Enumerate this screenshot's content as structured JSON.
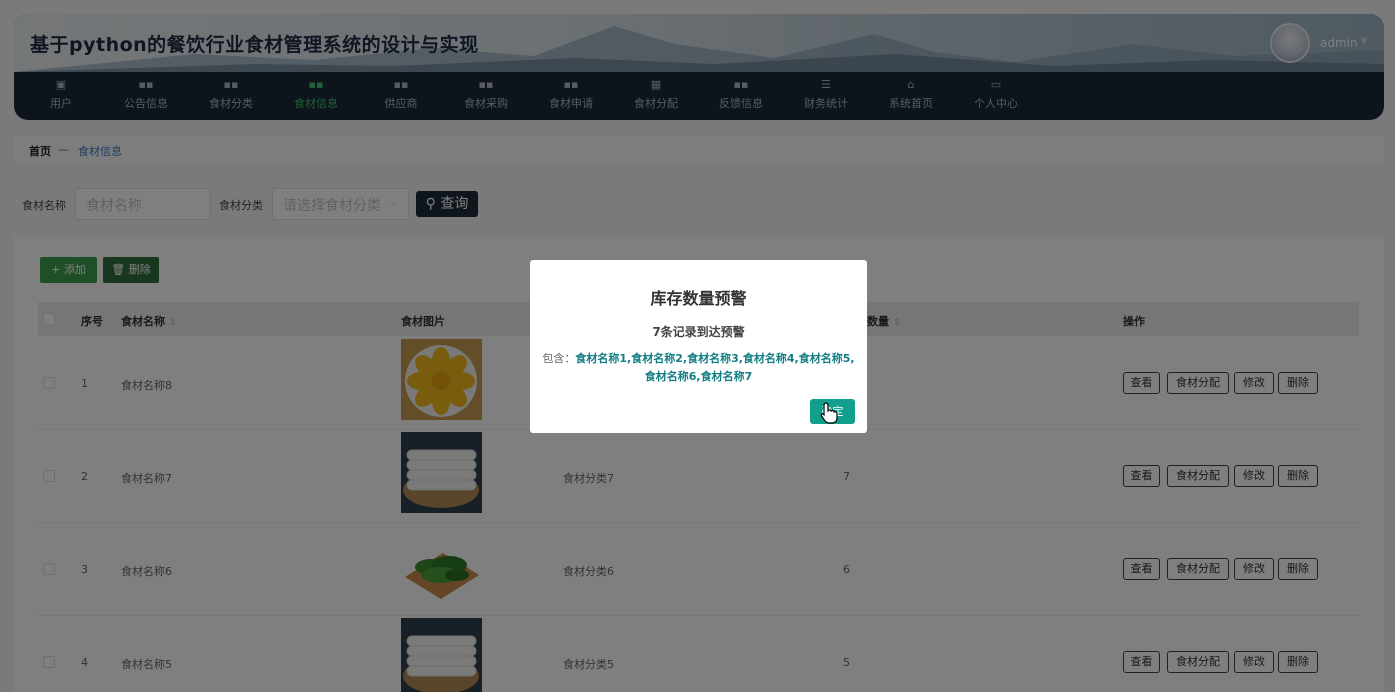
{
  "app": {
    "title": "基于python的餐饮行业食材管理系统的设计与实现",
    "user": "admin"
  },
  "nav": [
    {
      "label": "用户",
      "icon": "clipboard-icon"
    },
    {
      "label": "公告信息",
      "icon": "grid-icon"
    },
    {
      "label": "食材分类",
      "icon": "grid-icon"
    },
    {
      "label": "食材信息",
      "icon": "grid-icon",
      "active": true
    },
    {
      "label": "供应商",
      "icon": "grid-icon"
    },
    {
      "label": "食材采购",
      "icon": "grid-icon"
    },
    {
      "label": "食材申请",
      "icon": "grid-icon"
    },
    {
      "label": "食材分配",
      "icon": "table-icon"
    },
    {
      "label": "反馈信息",
      "icon": "grid-icon"
    },
    {
      "label": "财务统计",
      "icon": "sliders-icon"
    },
    {
      "label": "系统首页",
      "icon": "home-icon"
    },
    {
      "label": "个人中心",
      "icon": "card-icon"
    }
  ],
  "breadcrumb": {
    "home": "首页",
    "separator": "—",
    "current": "食材信息"
  },
  "search": {
    "name_label": "食材名称",
    "name_placeholder": "食材名称",
    "category_label": "食材分类",
    "category_placeholder": "请选择食材分类",
    "query_button": "查询"
  },
  "toolbar": {
    "add": "添加",
    "delete": "删除"
  },
  "table": {
    "headers": {
      "index": "序号",
      "name": "食材名称",
      "image": "食材图片",
      "quantity": "数量",
      "actions": "操作"
    },
    "rows": [
      {
        "index": "1",
        "name": "食材名称8",
        "category": "",
        "quantity": "",
        "image": "dumplings"
      },
      {
        "index": "2",
        "name": "食材名称7",
        "category": "食材分类7",
        "quantity": "7",
        "image": "rice-cakes"
      },
      {
        "index": "3",
        "name": "食材名称6",
        "category": "食材分类6",
        "quantity": "6",
        "image": "greens"
      },
      {
        "index": "4",
        "name": "食材名称5",
        "category": "食材分类5",
        "quantity": "5",
        "image": "rice-cakes"
      }
    ],
    "actions": [
      "查看",
      "食材分配",
      "修改",
      "删除"
    ]
  },
  "modal": {
    "title": "库存数量预警",
    "subtitle": "7条记录到达预警",
    "prefix": "包含：",
    "items_line1": "食材名称1,食材名称2,食材名称3,食材名称4,食材名称5,",
    "items_line2": "食材名称6,食材名称7",
    "confirm": "确定"
  },
  "colors": {
    "nav_bg": "#1c2838",
    "active": "#3cc46e",
    "confirm": "#12a08c",
    "link": "#137d84"
  }
}
